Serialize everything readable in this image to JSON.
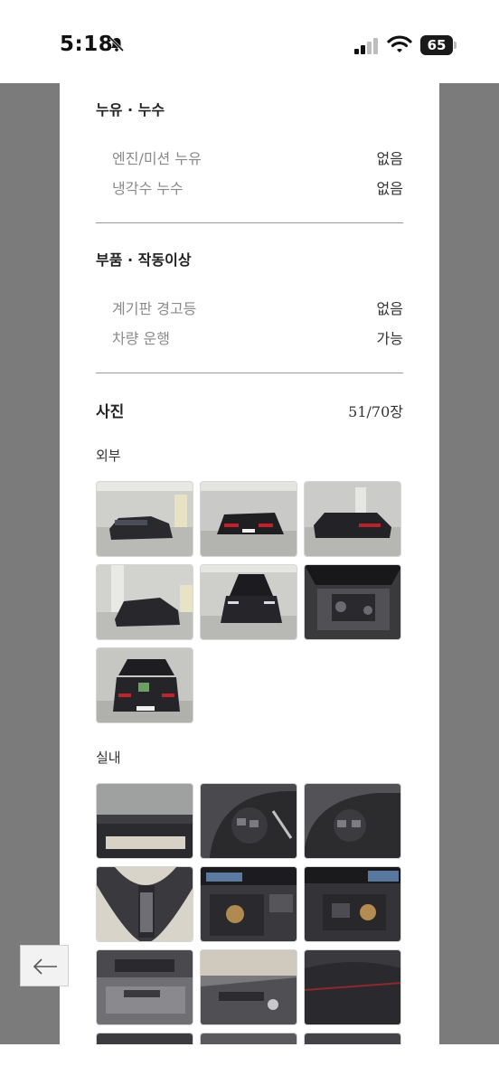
{
  "status_bar": {
    "time": "5:18",
    "battery": "65",
    "icons": [
      "bell-slash-icon",
      "signal-icon",
      "wifi-icon",
      "battery-icon"
    ]
  },
  "leak_section": {
    "title": "누유 · 누수",
    "rows": [
      {
        "label": "엔진/미션 누유",
        "value": "없음"
      },
      {
        "label": "냉각수 누수",
        "value": "없음"
      }
    ]
  },
  "parts_section": {
    "title": "부품 · 작동이상",
    "rows": [
      {
        "label": "계기판 경고등",
        "value": "없음"
      },
      {
        "label": "차량 운행",
        "value": "가능"
      }
    ]
  },
  "photo_section": {
    "title": "사진",
    "count": "51/70장",
    "exterior_label": "외부",
    "interior_label": "실내"
  },
  "colors": {
    "side_gray": "#7b7b7b",
    "divider": "#9a9a9a",
    "label_gray": "#8a8a8a"
  },
  "back_button_icon": "arrow-left-icon"
}
